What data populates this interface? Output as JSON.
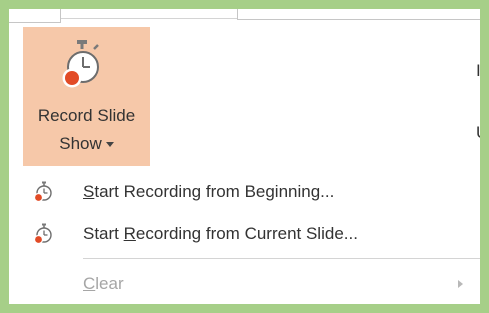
{
  "record_button": {
    "label_line1": "Record Slide",
    "label_line2": "Show",
    "icon": "stopwatch-record-icon",
    "background": "#f6c8a9"
  },
  "ribbon_cut_text": [
    "I",
    "U"
  ],
  "menu": {
    "items": [
      {
        "mnemonic": "S",
        "label_rest": "tart Recording from Beginning...",
        "icon": "stopwatch-record-icon",
        "enabled": true
      },
      {
        "label_pre": "Start ",
        "mnemonic": "R",
        "label_rest": "ecording from Current Slide...",
        "icon": "stopwatch-record-icon",
        "enabled": true
      },
      {
        "mnemonic": "C",
        "label_rest": "lear",
        "enabled": false,
        "has_submenu": true
      }
    ]
  },
  "colors": {
    "frame": "#a6cf88",
    "record_accent": "#e24b26",
    "disabled_text": "#a6a6a6"
  }
}
